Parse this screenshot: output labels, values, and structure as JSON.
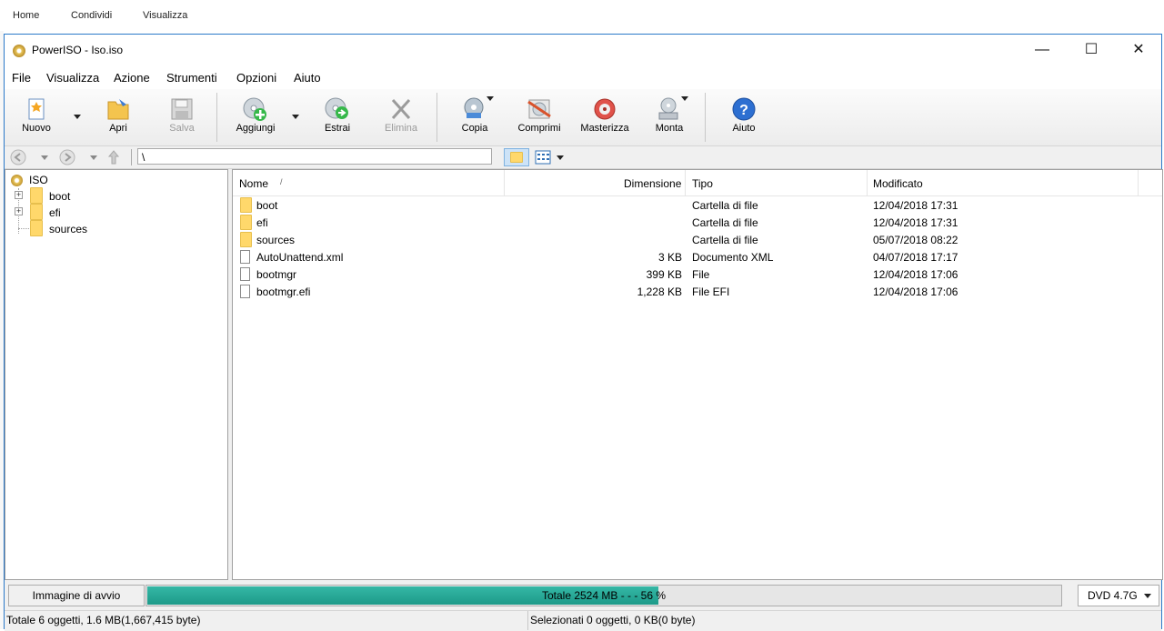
{
  "explorer": {
    "tabs": [
      "Home",
      "Condividi",
      "Visualizza"
    ]
  },
  "window": {
    "title": "PowerISO - Iso.iso",
    "controls": {
      "minimize": "—",
      "maximize": "☐",
      "close": "✕"
    }
  },
  "menu": [
    "File",
    "Visualizza",
    "Azione",
    "Strumenti",
    "Opzioni",
    "Aiuto"
  ],
  "toolbar": {
    "new": "Nuovo",
    "open": "Apri",
    "save": "Salva",
    "add": "Aggiungi",
    "extract": "Estrai",
    "delete": "Elimina",
    "copy": "Copia",
    "compress": "Comprimi",
    "burn": "Masterizza",
    "mount": "Monta",
    "help": "Aiuto"
  },
  "address": {
    "path": "\\"
  },
  "tree": {
    "root": "ISO",
    "items": [
      "boot",
      "efi",
      "sources"
    ]
  },
  "list": {
    "columns": {
      "name": "Nome",
      "size": "Dimensione",
      "type": "Tipo",
      "modified": "Modificato"
    },
    "rows": [
      {
        "name": "boot",
        "size": "",
        "type": "Cartella di file",
        "modified": "12/04/2018 17:31",
        "kind": "folder"
      },
      {
        "name": "efi",
        "size": "",
        "type": "Cartella di file",
        "modified": "12/04/2018 17:31",
        "kind": "folder"
      },
      {
        "name": "sources",
        "size": "",
        "type": "Cartella di file",
        "modified": "05/07/2018 08:22",
        "kind": "folder"
      },
      {
        "name": "AutoUnattend.xml",
        "size": "3 KB",
        "type": "Documento XML",
        "modified": "04/07/2018 17:17",
        "kind": "file"
      },
      {
        "name": "bootmgr",
        "size": "399 KB",
        "type": "File",
        "modified": "12/04/2018 17:06",
        "kind": "file"
      },
      {
        "name": "bootmgr.efi",
        "size": "1,228 KB",
        "type": "File EFI",
        "modified": "12/04/2018 17:06",
        "kind": "file"
      }
    ]
  },
  "status": {
    "boot_image": "Immagine di avvio",
    "progress_text": "Totale  2524 MB  - - -  56 %",
    "progress_percent": 56,
    "media": "DVD 4.7G",
    "total": "Totale 6 oggetti, 1.6 MB(1,667,415 byte)",
    "selected": "Selezionati 0 oggetti, 0 KB(0 byte)"
  }
}
